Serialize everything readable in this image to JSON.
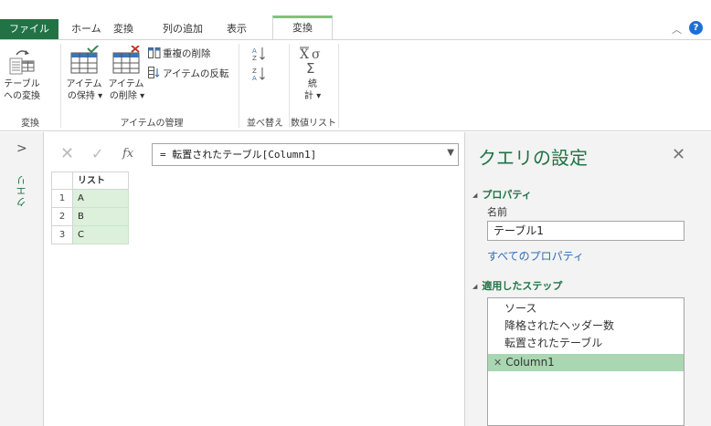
{
  "tabs": [
    {
      "label": "ファイル"
    },
    {
      "label": "ホーム"
    },
    {
      "label": "変換"
    },
    {
      "label": "列の追加"
    },
    {
      "label": "表示"
    },
    {
      "label": "変換"
    }
  ],
  "help_label": "?",
  "ribbon": {
    "convert_table_label_line1": "テーブル",
    "convert_table_label_line2": "への変換",
    "keep_items_line1": "アイテム",
    "keep_items_line2": "の保持 ▾",
    "remove_items_line1": "アイテム",
    "remove_items_line2": "の削除 ▾",
    "remove_duplicates": "重複の削除",
    "reverse_items": "アイテムの反転",
    "statistics_line1": "統",
    "statistics_line2": "計 ▾",
    "groups": {
      "convert": "変換",
      "manage_items": "アイテムの管理",
      "sort": "並べ替え",
      "numeric_list": "数値リスト"
    }
  },
  "queries_pane": {
    "label": "クエリ",
    "expand_glyph": ">"
  },
  "formula_bar": {
    "cancel_glyph": "✕",
    "ok_glyph": "✓",
    "fx_label": "fx",
    "formula": "= 転置されたテーブル[Column1]"
  },
  "grid": {
    "column_header": "リスト",
    "rows": [
      {
        "num": "1",
        "value": "A"
      },
      {
        "num": "2",
        "value": "B"
      },
      {
        "num": "3",
        "value": "C"
      }
    ]
  },
  "query_settings": {
    "title": "クエリの設定",
    "close_glyph": "✕",
    "properties_header": "プロパティ",
    "name_label": "名前",
    "name_value": "テーブル1",
    "all_properties_link": "すべてのプロパティ",
    "applied_steps_header": "適用したステップ",
    "steps": [
      {
        "label": "ソース"
      },
      {
        "label": "降格されたヘッダー数"
      },
      {
        "label": "転置されたテーブル"
      },
      {
        "label": "Column1"
      }
    ]
  },
  "colors": {
    "accent": "#217346",
    "selection": "#a8d7b1",
    "list_fill": "#dcf0dc",
    "link": "#2e6db5"
  }
}
